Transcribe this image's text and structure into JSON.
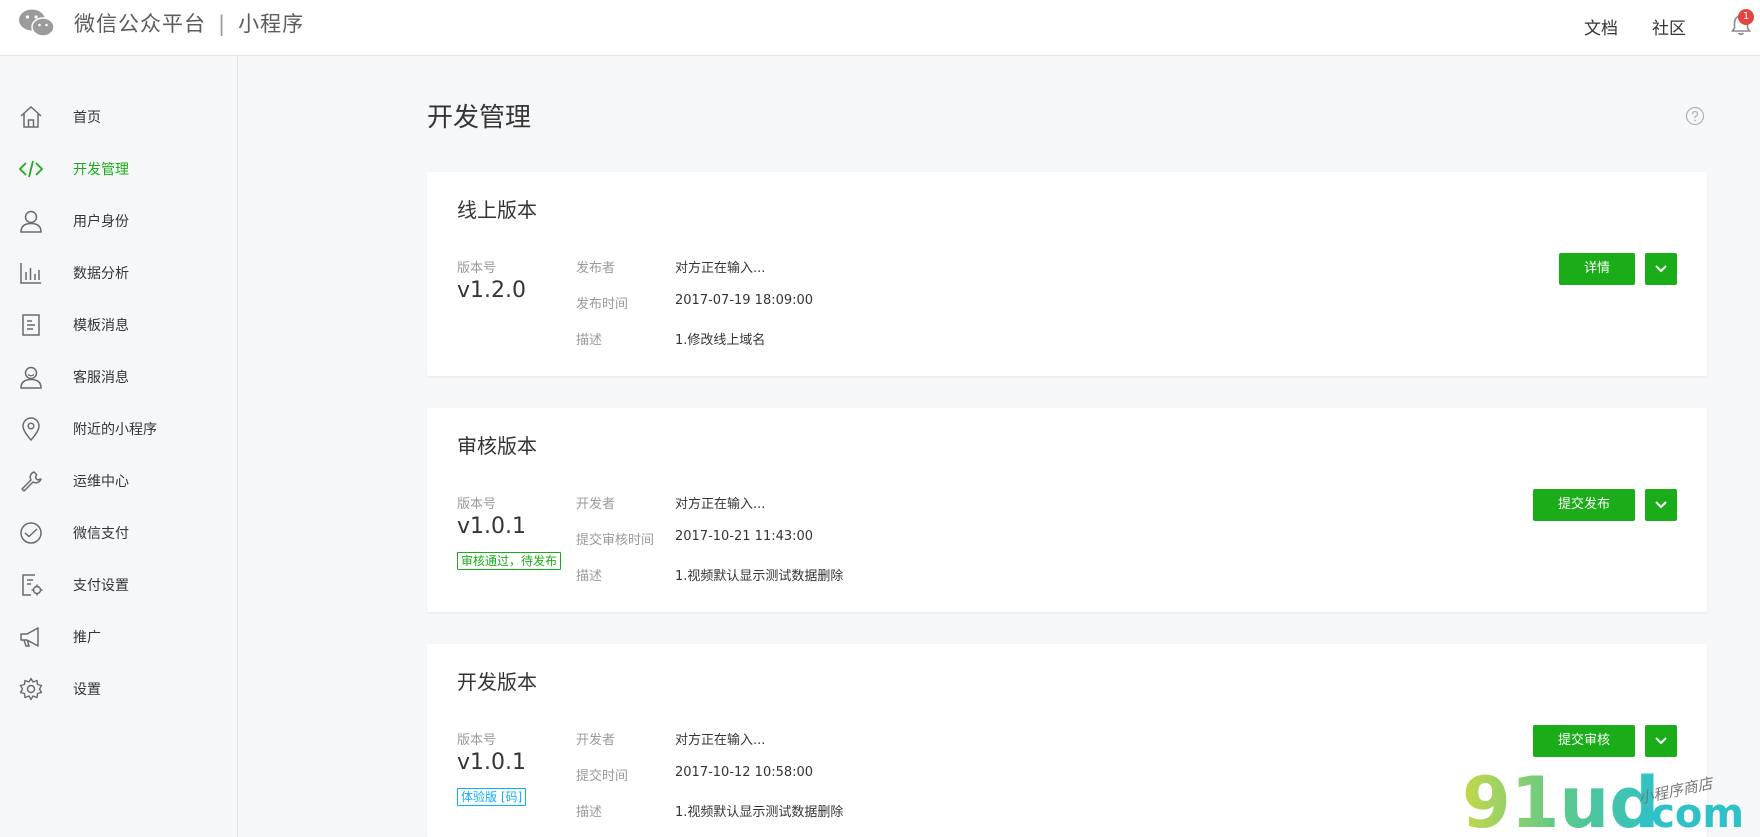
{
  "header": {
    "brand": "微信公众平台",
    "separator": "|",
    "product": "小程序",
    "links": [
      "文档",
      "社区"
    ],
    "notification_count": "1"
  },
  "sidebar": {
    "items": [
      {
        "label": "首页",
        "icon": "home-icon"
      },
      {
        "label": "开发管理",
        "icon": "code-icon",
        "active": true
      },
      {
        "label": "用户身份",
        "icon": "user-icon"
      },
      {
        "label": "数据分析",
        "icon": "bar-chart-icon"
      },
      {
        "label": "模板消息",
        "icon": "document-icon"
      },
      {
        "label": "客服消息",
        "icon": "support-user-icon"
      },
      {
        "label": "附近的小程序",
        "icon": "location-pin-icon"
      },
      {
        "label": "运维中心",
        "icon": "wrench-icon"
      },
      {
        "label": "微信支付",
        "icon": "payment-icon"
      },
      {
        "label": "支付设置",
        "icon": "payment-settings-icon"
      },
      {
        "label": "推广",
        "icon": "megaphone-icon"
      },
      {
        "label": "设置",
        "icon": "gear-icon"
      }
    ]
  },
  "main": {
    "title": "开发管理",
    "cards": [
      {
        "title": "线上版本",
        "version_label": "版本号",
        "version": "v1.2.0",
        "tag": "",
        "fields": [
          {
            "label": "发布者",
            "value": "对方正在输入..."
          },
          {
            "label": "发布时间",
            "value": "2017-07-19 18:09:00"
          },
          {
            "label": "描述",
            "value": "1.修改线上域名"
          }
        ],
        "button": "详情"
      },
      {
        "title": "审核版本",
        "version_label": "版本号",
        "version": "v1.0.1",
        "tag": "审核通过，待发布",
        "fields": [
          {
            "label": "开发者",
            "value": "对方正在输入..."
          },
          {
            "label": "提交审核时间",
            "value": "2017-10-21 11:43:00"
          },
          {
            "label": "描述",
            "value": "1.视频默认显示测试数据删除"
          }
        ],
        "button": "提交发布"
      },
      {
        "title": "开发版本",
        "version_label": "版本号",
        "version": "v1.0.1",
        "tag": "体验版 [码]",
        "fields": [
          {
            "label": "开发者",
            "value": "对方正在输入..."
          },
          {
            "label": "提交时间",
            "value": "2017-10-12 10:58:00"
          },
          {
            "label": "描述",
            "value": "1.视频默认显示测试数据删除"
          }
        ],
        "button": "提交审核"
      }
    ]
  },
  "watermark": {
    "text": "91ud",
    "suffix": ".com",
    "tagline": "小程序商店"
  },
  "colors": {
    "accent": "#1aad19",
    "tag_blue": "#10aeff",
    "badge": "#e64340"
  }
}
